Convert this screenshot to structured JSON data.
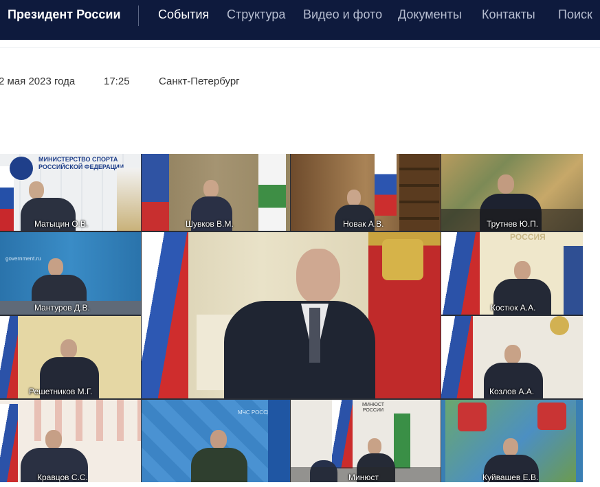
{
  "header": {
    "brand": "Президент России",
    "nav": [
      {
        "label": "События",
        "active": true
      },
      {
        "label": "Структура",
        "active": false
      },
      {
        "label": "Видео и фото",
        "active": false
      },
      {
        "label": "Документы",
        "active": false
      },
      {
        "label": "Контакты",
        "active": false
      },
      {
        "label": "Поиск",
        "active": false
      }
    ]
  },
  "event": {
    "date": "2 мая 2023 года",
    "time": "17:25",
    "place": "Санкт-Петербург"
  },
  "video": {
    "tiles": [
      {
        "caption": "Матыцин О.В.",
        "wall_text": "МИНИСТЕРСТВО СПОРТА РОССИЙСКОЙ ФЕДЕРАЦИИ"
      },
      {
        "caption": "Шувков В.М."
      },
      {
        "caption": "Новак А.В."
      },
      {
        "caption": "Трутнев Ю.П."
      },
      {
        "caption": "Мантуров Д.В.",
        "wall_text": "government.ru"
      },
      {
        "caption": "Костюк А.А.",
        "wall_text": "РОССИЯ"
      },
      {
        "caption": "Решетников М.Г."
      },
      {
        "caption": "Козлов А.А."
      },
      {
        "caption": "Кравцов С.С."
      },
      {
        "caption": "",
        "wall_text": "МЧС РОССИИ"
      },
      {
        "caption": "Минюст",
        "wall_text": "МИНЮСТ РОССИИ"
      },
      {
        "caption": "Куйвашев Е.В."
      }
    ]
  }
}
